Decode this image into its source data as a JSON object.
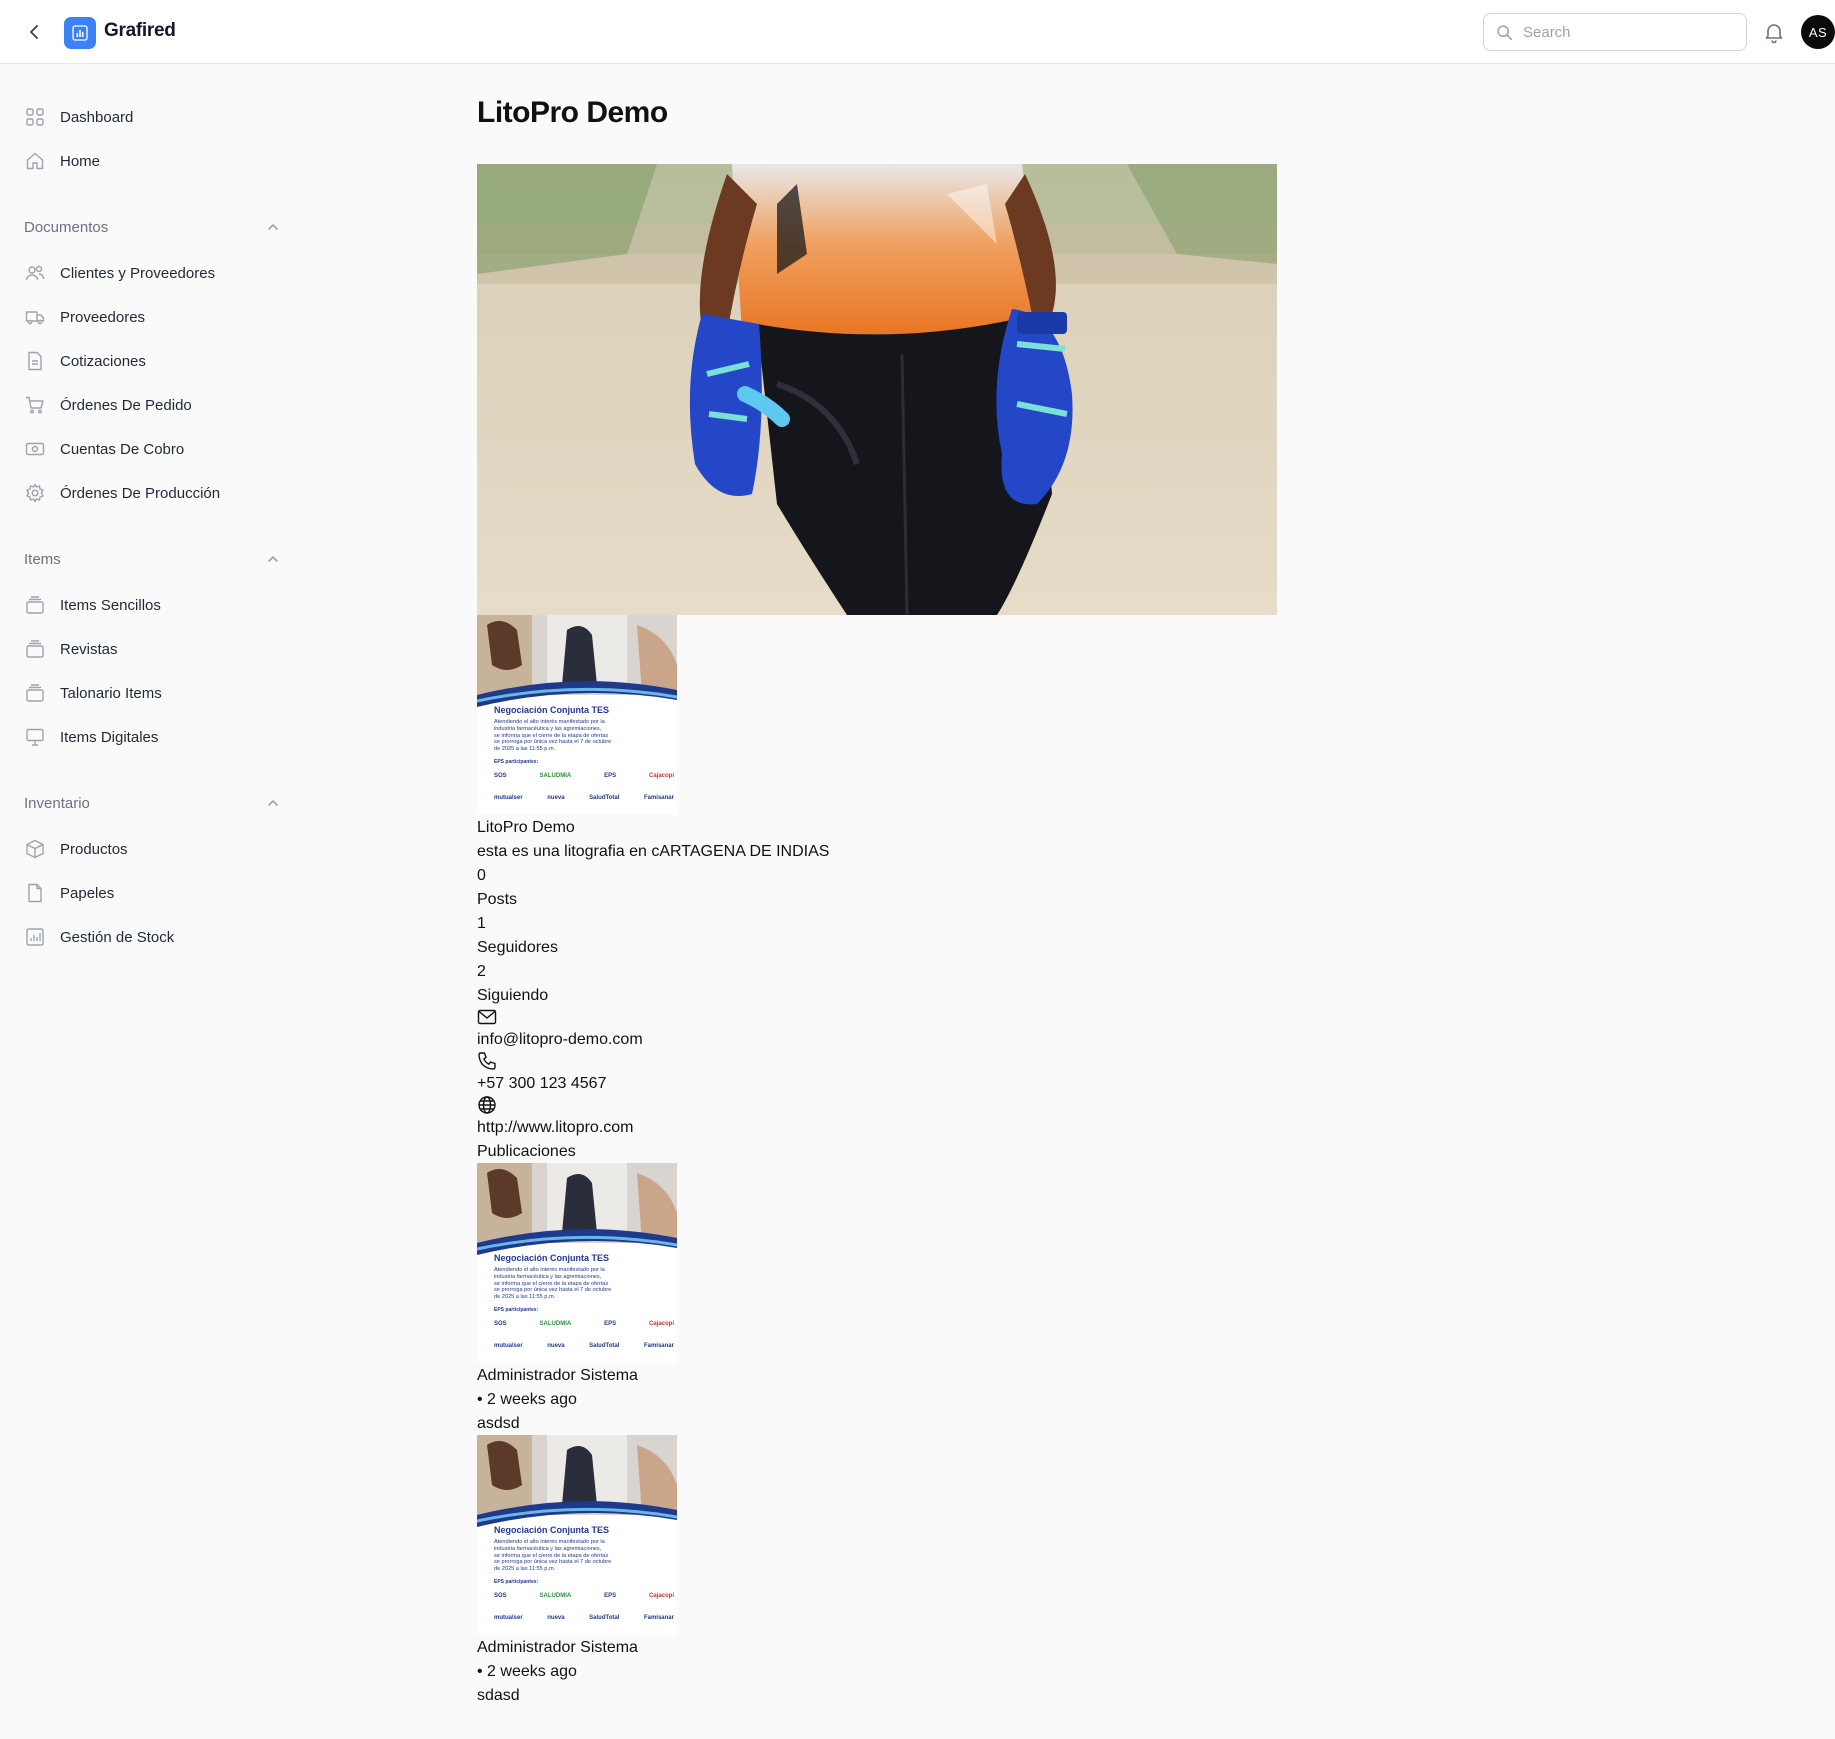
{
  "app": {
    "name": "Grafired",
    "search_placeholder": "Search",
    "avatar_initials": "AS"
  },
  "sidebar": {
    "top_items": [
      {
        "label": "Dashboard",
        "icon": "grid-icon"
      },
      {
        "label": "Home",
        "icon": "home-icon"
      }
    ],
    "groups": [
      {
        "label": "Documentos",
        "items": [
          {
            "label": "Clientes y Proveedores",
            "icon": "users-icon"
          },
          {
            "label": "Proveedores",
            "icon": "truck-icon"
          },
          {
            "label": "Cotizaciones",
            "icon": "document-icon"
          },
          {
            "label": "Órdenes De Pedido",
            "icon": "cart-icon"
          },
          {
            "label": "Cuentas De Cobro",
            "icon": "cash-icon"
          },
          {
            "label": "Órdenes De Producción",
            "icon": "gear-icon"
          }
        ]
      },
      {
        "label": "Items",
        "items": [
          {
            "label": "Items Sencillos",
            "icon": "layers-icon"
          },
          {
            "label": "Revistas",
            "icon": "layers-icon"
          },
          {
            "label": "Talonario Items",
            "icon": "layers-icon"
          },
          {
            "label": "Items Digitales",
            "icon": "monitor-icon"
          }
        ]
      },
      {
        "label": "Inventario",
        "items": [
          {
            "label": "Productos",
            "icon": "cube-icon"
          },
          {
            "label": "Papeles",
            "icon": "file-icon"
          },
          {
            "label": "Gestión de Stock",
            "icon": "chart-icon"
          }
        ]
      }
    ]
  },
  "profile": {
    "page_title": "LitoPro Demo",
    "name": "LitoPro Demo",
    "description": "esta es una litografia en cARTAGENA DE INDIAS",
    "posts_count": "0",
    "posts_label": "Posts",
    "followers_count": "1",
    "followers_label": "Seguidores",
    "following_count": "2",
    "following_label": "Siguiendo",
    "email": "info@litopro-demo.com",
    "phone": "+57 300 123 4567",
    "website": "http://www.litopro.com",
    "publications_heading": "Publicaciones"
  },
  "flyer": {
    "title": "Negociación Conjunta TES",
    "body_lines": [
      "Atendiendo el alto interés manifestado por la",
      "industria farmacéutica y las agremiaciones,",
      "se informa que el cierre de la etapa de ofertas",
      "se prorroga por única vez hasta el 7 de octubre",
      "de 2025 a las 11:55 p.m."
    ],
    "eps_label": "EPS participantes:",
    "logos_row1": [
      "SOS",
      "SALUDMIA",
      "EPS",
      "Cajacopi"
    ],
    "logos_row2": [
      "mutualser",
      "nueva",
      "SaludTotal",
      "Famisanar"
    ]
  },
  "posts": [
    {
      "author": "Administrador Sistema",
      "time": "• 2 weeks ago",
      "text": "asdsd"
    },
    {
      "author": "Administrador Sistema",
      "time": "• 2 weeks ago",
      "text": "sdasd"
    }
  ]
}
